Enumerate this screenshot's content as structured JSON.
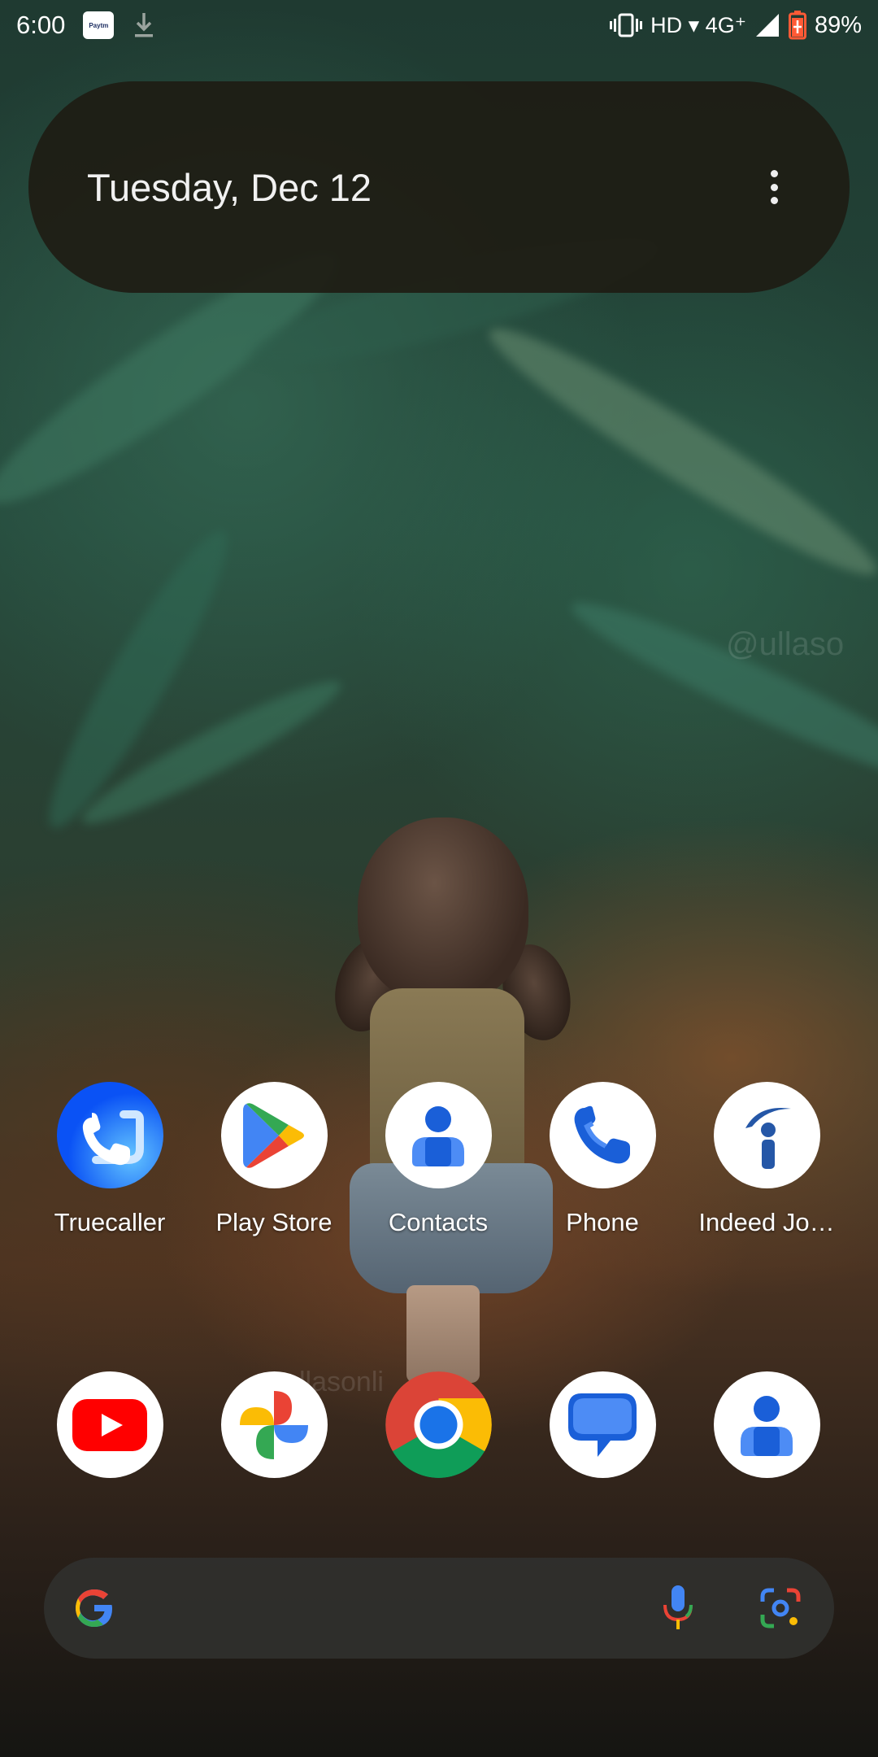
{
  "status_bar": {
    "time": "6:00",
    "network": "HD ▾ 4G⁺",
    "battery": "89%",
    "notification_icons": [
      "paytm-icon",
      "download-icon"
    ],
    "system_icons": [
      "vibrate-icon",
      "signal-icon",
      "battery-icon"
    ]
  },
  "date_widget": {
    "date": "Tuesday, Dec 12",
    "menu_icon": "more-vert-icon"
  },
  "wallpaper": {
    "watermark_1": "@ullaso",
    "watermark_2": "llasonli"
  },
  "apps_row1": [
    {
      "label": "Truecaller",
      "icon": "truecaller-icon"
    },
    {
      "label": "Play Store",
      "icon": "play-store-icon"
    },
    {
      "label": "Contacts",
      "icon": "contacts-icon"
    },
    {
      "label": "Phone",
      "icon": "phone-icon"
    },
    {
      "label": "Indeed Jo…",
      "icon": "indeed-icon"
    }
  ],
  "dock": [
    {
      "icon": "youtube-icon"
    },
    {
      "icon": "google-photos-icon"
    },
    {
      "icon": "chrome-icon"
    },
    {
      "icon": "messages-icon"
    },
    {
      "icon": "contacts-icon"
    }
  ],
  "search_bar": {
    "icons": [
      "google-g-icon",
      "mic-icon",
      "lens-icon"
    ]
  },
  "colors": {
    "widget_bg": "#1e1c14",
    "search_bg": "#30302e",
    "google_blue": "#4285F4",
    "google_red": "#EA4335",
    "google_yellow": "#FBBC05",
    "google_green": "#34A853",
    "truecaller_blue": "#0a52f5",
    "youtube_red": "#ff0000"
  }
}
